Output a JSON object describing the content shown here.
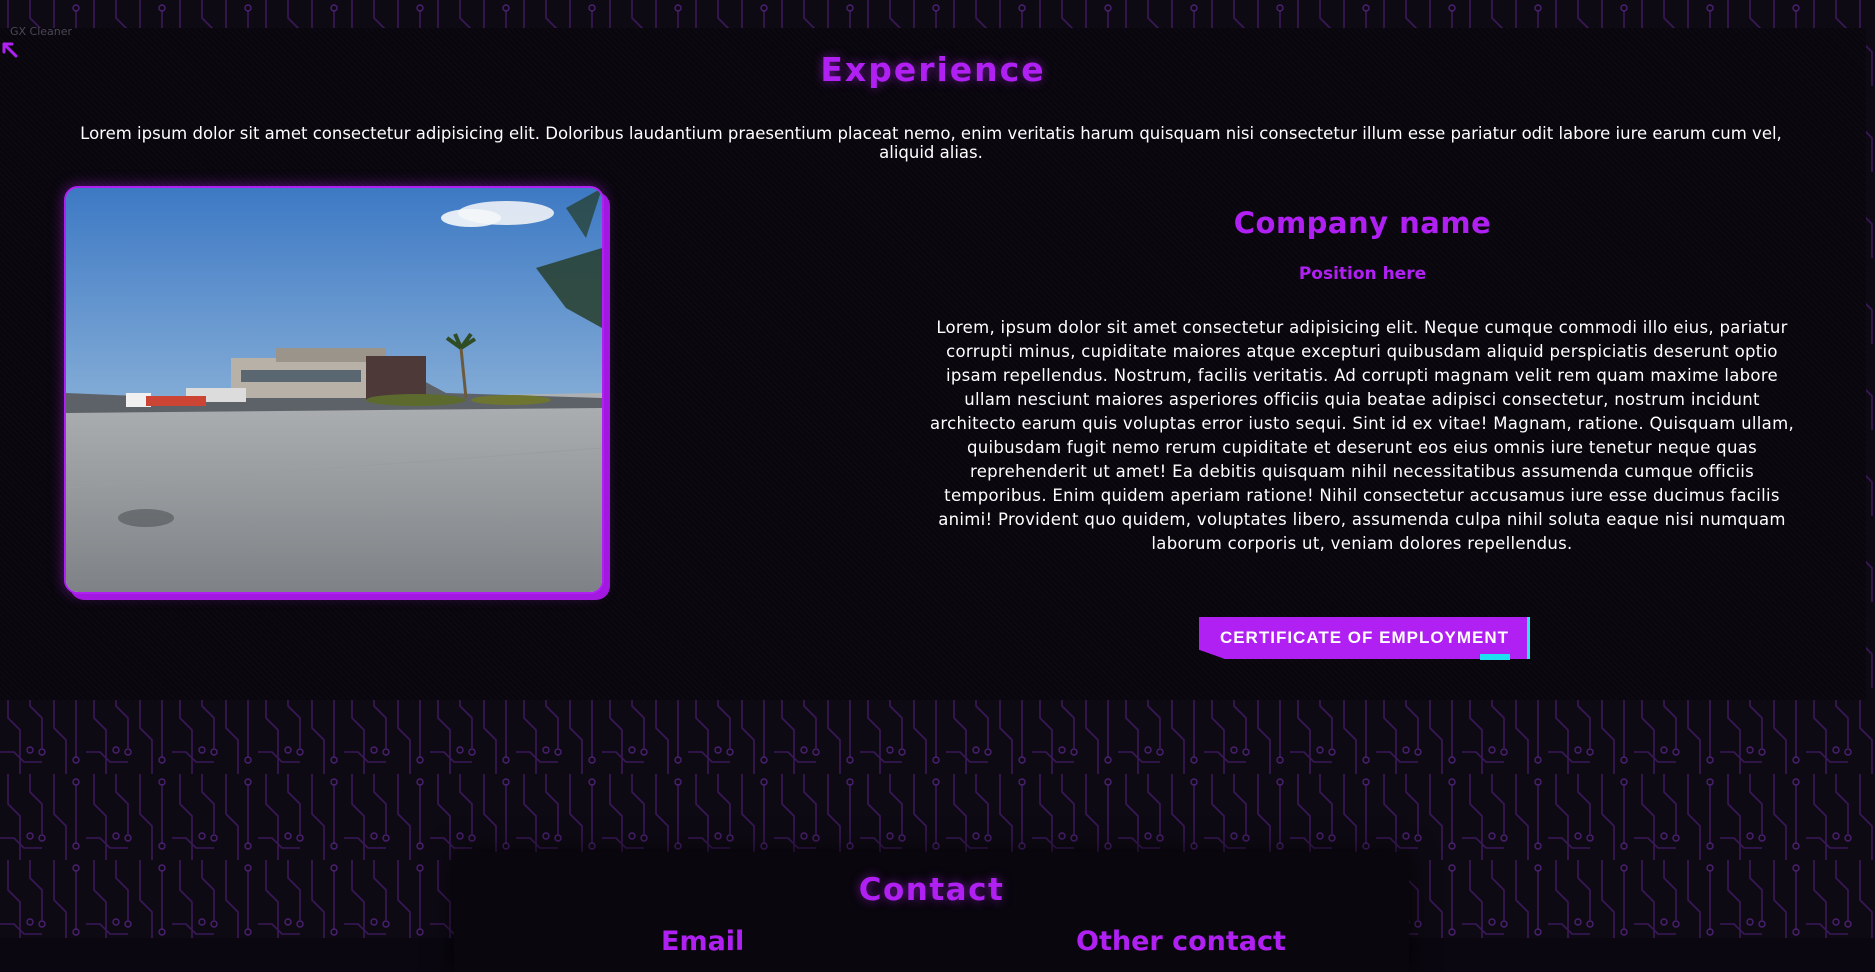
{
  "page_label": "GX Cleaner",
  "colors": {
    "accent": "#b120f3",
    "glitch": "#29e4f4",
    "background": "#0a0710"
  },
  "icons": {
    "back": "arrow-up-left-icon"
  },
  "experience": {
    "title": "Experience",
    "intro": "Lorem ipsum dolor sit amet consectetur adipisicing elit. Doloribus laudantium praesentium placeat nemo, enim veritatis harum quisquam nisi consectetur illum esse pariatur odit labore iure earum cum vel, aliquid alias.",
    "company_name": "Company name",
    "position": "Position here",
    "description": "Lorem, ipsum dolor sit amet consectetur adipisicing elit. Neque cumque commodi illo eius, pariatur corrupti minus, cupiditate maiores atque excepturi quibusdam aliquid perspiciatis deserunt optio ipsam repellendus. Nostrum, facilis veritatis. Ad corrupti magnam velit rem quam maxime labore ullam nesciunt maiores asperiores officiis quia beatae adipisci consectetur, nostrum incidunt architecto earum quis voluptas error iusto sequi. Sint id ex vitae! Magnam, ratione. Quisquam ullam, quibusdam fugit nemo rerum cupiditate et deserunt eos eius omnis iure tenetur neque quas reprehenderit ut amet! Ea debitis quisquam nihil necessitatibus assumenda cumque officiis temporibus. Enim quidem aperiam ratione! Nihil consectetur accusamus iure esse ducimus facilis animi! Provident quo quidem, voluptates libero, assumenda culpa nihil soluta eaque nisi numquam laborum corporis ut, veniam dolores repellendus.",
    "certificate_button": "CERTIFICATE OF EMPLOYMENT"
  },
  "contact": {
    "title": "Contact",
    "email_label": "Email",
    "other_label": "Other contact"
  }
}
